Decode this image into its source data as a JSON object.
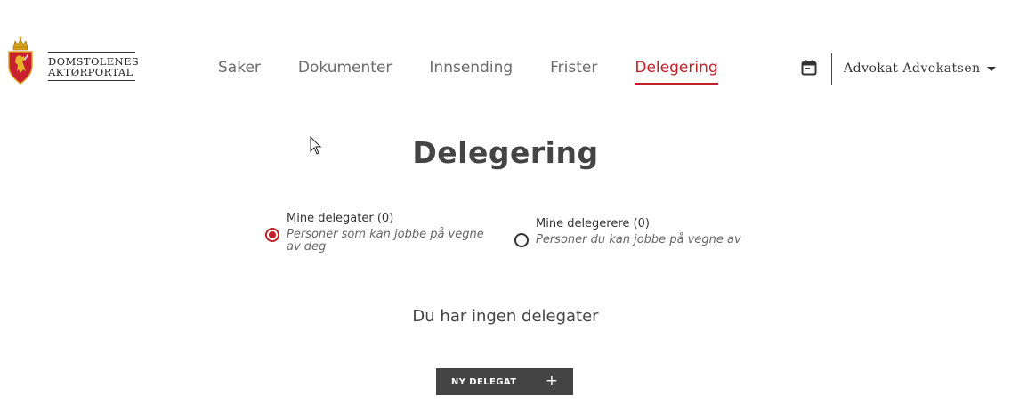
{
  "header": {
    "logo": {
      "line1": "DOMSTOLENES",
      "line2": "AKTØRPORTAL"
    },
    "nav": [
      {
        "label": "Saker",
        "active": false
      },
      {
        "label": "Dokumenter",
        "active": false
      },
      {
        "label": "Innsending",
        "active": false
      },
      {
        "label": "Frister",
        "active": false
      },
      {
        "label": "Delegering",
        "active": true
      }
    ],
    "calendar_icon": "calendar-icon",
    "user": {
      "name": "Advokat Advokatsen",
      "icon": "caret-down-icon"
    }
  },
  "main": {
    "title": "Delegering",
    "radios": [
      {
        "label": "Mine delegater (0)",
        "description": "Personer som kan jobbe på vegne av deg",
        "checked": true
      },
      {
        "label": "Mine delegerere (0)",
        "description": "Personer du kan jobbe på vegne av",
        "checked": false
      }
    ],
    "empty_message": "Du har ingen delegater",
    "new_button": {
      "label": "NY DELEGAT",
      "icon": "plus-icon"
    }
  },
  "colors": {
    "accent": "#c12026",
    "text": "#333333",
    "button_bg": "#444444"
  }
}
